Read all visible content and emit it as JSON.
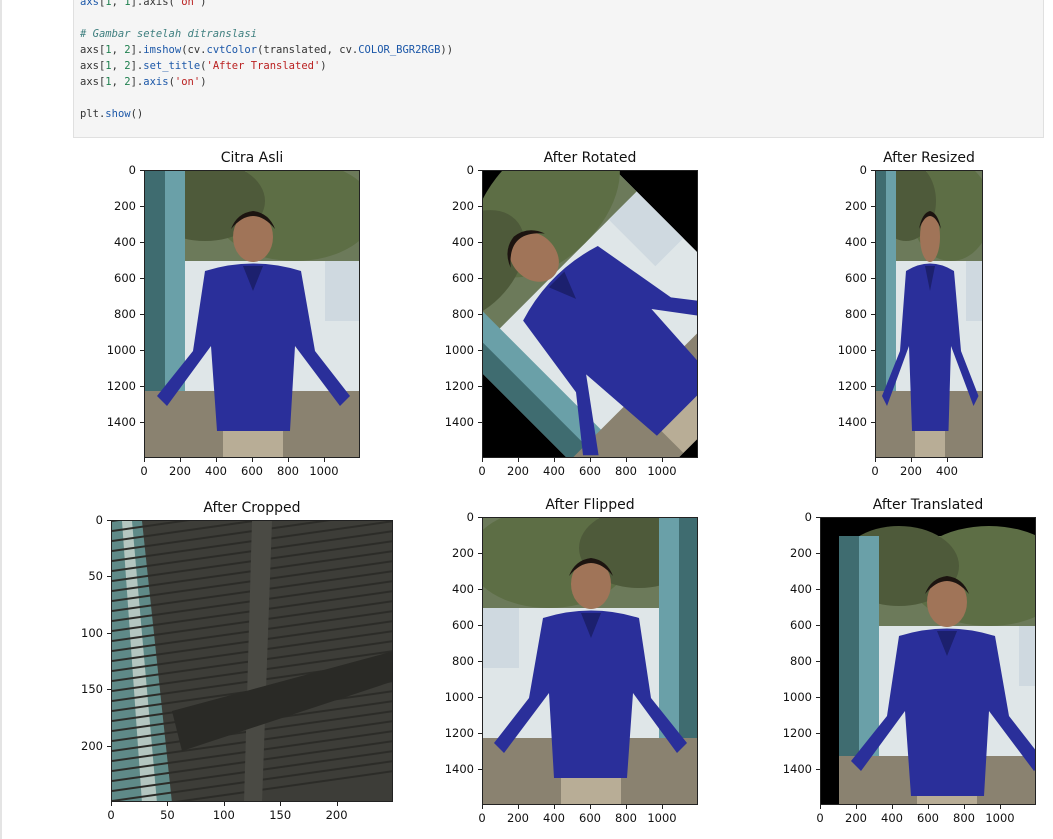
{
  "code": {
    "lines": [
      {
        "type": "partial",
        "text": "axs[1, 1].axis('on')"
      },
      {
        "type": "blank",
        "text": ""
      },
      {
        "type": "comment",
        "text": "# Gambar setelah ditranslasi"
      },
      {
        "type": "code",
        "text": "axs[1, 2].imshow(cv.cvtColor(translated, cv.COLOR_BGR2RGB))"
      },
      {
        "type": "code",
        "text": "axs[1, 2].set_title('After Translated')"
      },
      {
        "type": "code",
        "text": "axs[1, 2].axis('on')"
      },
      {
        "type": "blank",
        "text": ""
      },
      {
        "type": "code",
        "text": "plt.show()"
      }
    ]
  },
  "subplots": [
    {
      "title": "Citra Asli",
      "image": "original",
      "yticks": [
        "0",
        "200",
        "400",
        "600",
        "800",
        "1000",
        "1200",
        "1400"
      ],
      "xticks": [
        "0",
        "200",
        "400",
        "600",
        "800",
        "1000"
      ]
    },
    {
      "title": "After Rotated",
      "image": "rotated",
      "yticks": [
        "0",
        "200",
        "400",
        "600",
        "800",
        "1000",
        "1200",
        "1400"
      ],
      "xticks": [
        "0",
        "200",
        "400",
        "600",
        "800",
        "1000"
      ]
    },
    {
      "title": "After Resized",
      "image": "resized",
      "yticks": [
        "0",
        "200",
        "400",
        "600",
        "800",
        "1000",
        "1200",
        "1400"
      ],
      "xticks": [
        "0",
        "200",
        "400"
      ]
    },
    {
      "title": "After Cropped",
      "image": "cropped",
      "yticks": [
        "0",
        "50",
        "100",
        "150",
        "200"
      ],
      "xticks": [
        "0",
        "50",
        "100",
        "150",
        "200"
      ]
    },
    {
      "title": "After Flipped",
      "image": "flipped",
      "yticks": [
        "0",
        "200",
        "400",
        "600",
        "800",
        "1000",
        "1200",
        "1400"
      ],
      "xticks": [
        "0",
        "200",
        "400",
        "600",
        "800",
        "1000"
      ]
    },
    {
      "title": "After Translated",
      "image": "translated",
      "yticks": [
        "0",
        "200",
        "400",
        "600",
        "800",
        "1000",
        "1200",
        "1400"
      ],
      "xticks": [
        "0",
        "200",
        "400",
        "600",
        "800",
        "1000"
      ]
    }
  ],
  "colors": {
    "shirt": "#2a2f9a",
    "background_black": "#000000",
    "tree": "#4a5a3a",
    "sky": "#e6ecef"
  }
}
